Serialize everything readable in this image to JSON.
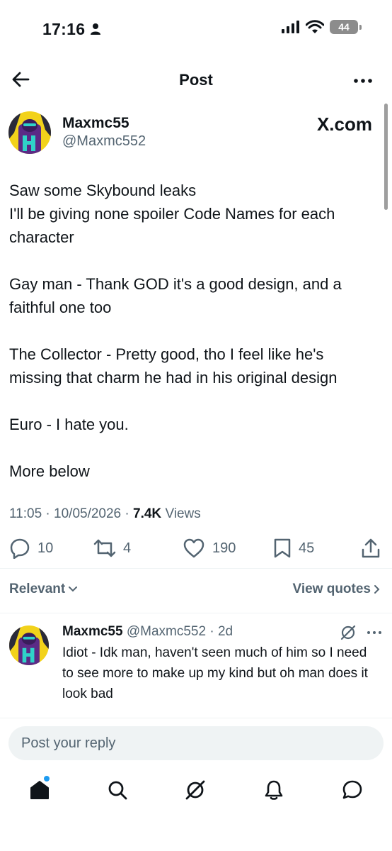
{
  "status_bar": {
    "time": "17:16",
    "battery": "44"
  },
  "header": {
    "title": "Post"
  },
  "post": {
    "display_name": "Maxmc55",
    "handle": "@Maxmc552",
    "source_mark": "X.com",
    "text": "Saw some Skybound leaks\nI'll be giving none spoiler Code Names for each character\n\nGay man - Thank GOD it's a good design, and a faithful one too\n\nThe Collector - Pretty good, tho I feel like he's missing that charm he had in his original design\n\nEuro - I hate you.\n\nMore below",
    "time": "11:05",
    "date": "10/05/2026",
    "views_count": "7.4K",
    "views_label": "Views",
    "replies": "10",
    "reposts": "4",
    "likes": "190",
    "bookmarks": "45"
  },
  "filters": {
    "relevant": "Relevant",
    "view_quotes": "View quotes"
  },
  "reply": {
    "display_name": "Maxmc55",
    "handle": "@Maxmc552",
    "age": "2d",
    "text": "Idiot - Idk man, haven't seen much of him so I need to see more to make up my kind but oh man does it look bad"
  },
  "composer": {
    "placeholder": "Post your reply"
  },
  "colors": {
    "accent": "#1d9bf0",
    "secondary_text": "#536471",
    "primary_text": "#0f1419"
  },
  "icons": [
    "back-arrow-icon",
    "more-icon",
    "reply-icon",
    "repost-icon",
    "like-icon",
    "bookmark-icon",
    "share-icon",
    "grok-icon",
    "home-icon",
    "search-icon",
    "notifications-icon",
    "messages-icon"
  ]
}
